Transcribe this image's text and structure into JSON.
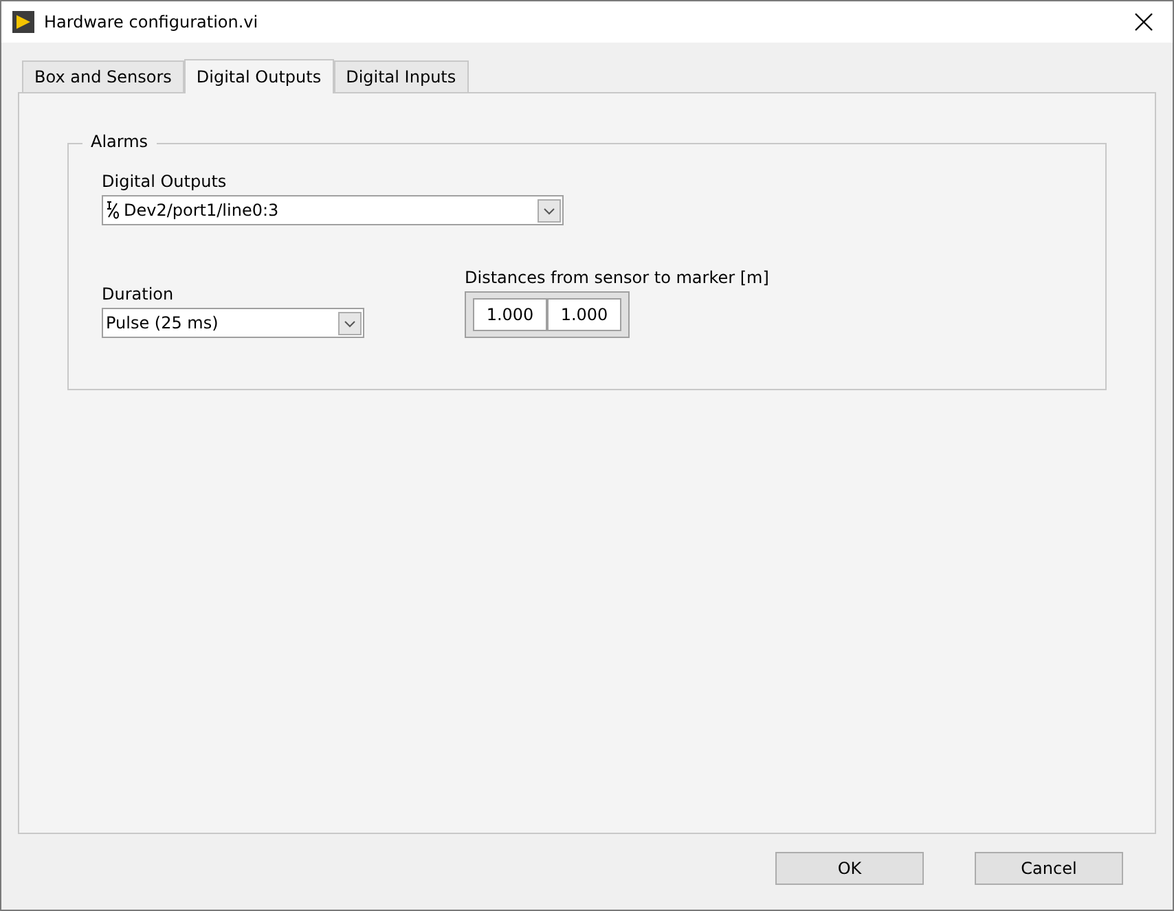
{
  "window": {
    "title": "Hardware configuration.vi"
  },
  "tabs": [
    {
      "label": "Box and Sensors",
      "selected": false
    },
    {
      "label": "Digital Outputs",
      "selected": true
    },
    {
      "label": "Digital Inputs",
      "selected": false
    }
  ],
  "group": {
    "title": "Alarms",
    "digital_outputs": {
      "label": "Digital Outputs",
      "value": "Dev2/port1/line0:3"
    },
    "duration": {
      "label": "Duration",
      "value": "Pulse (25 ms)"
    },
    "distances": {
      "label": "Distances from sensor to marker [m]",
      "values": [
        "1.000",
        "1.000"
      ]
    }
  },
  "buttons": [
    "OK",
    "Cancel"
  ]
}
